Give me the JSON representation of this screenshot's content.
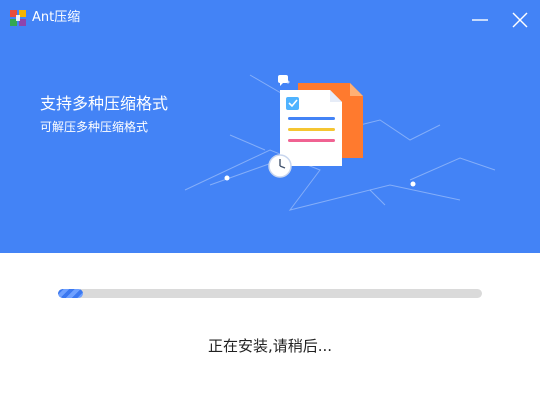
{
  "app": {
    "title": "Ant压缩",
    "logo_icon": "ant-zip-logo-icon",
    "minimize_icon": "minimize-icon",
    "close_icon": "close-icon"
  },
  "banner": {
    "headline": "支持多种压缩格式",
    "subline": "可解压多种压缩格式",
    "background_color": "#4383f6",
    "illustration_icons": [
      "document-icon",
      "checkbox-icon",
      "clock-icon",
      "chat-bubble-icon"
    ]
  },
  "install": {
    "progress_percent": 6,
    "status": "正在安装,请稍后..."
  },
  "colors": {
    "accent": "#3b78f0",
    "track": "#dadada",
    "document_back": "#ff7a2e",
    "document_lines": [
      "#4383f6",
      "#f5c531",
      "#f06292"
    ]
  }
}
